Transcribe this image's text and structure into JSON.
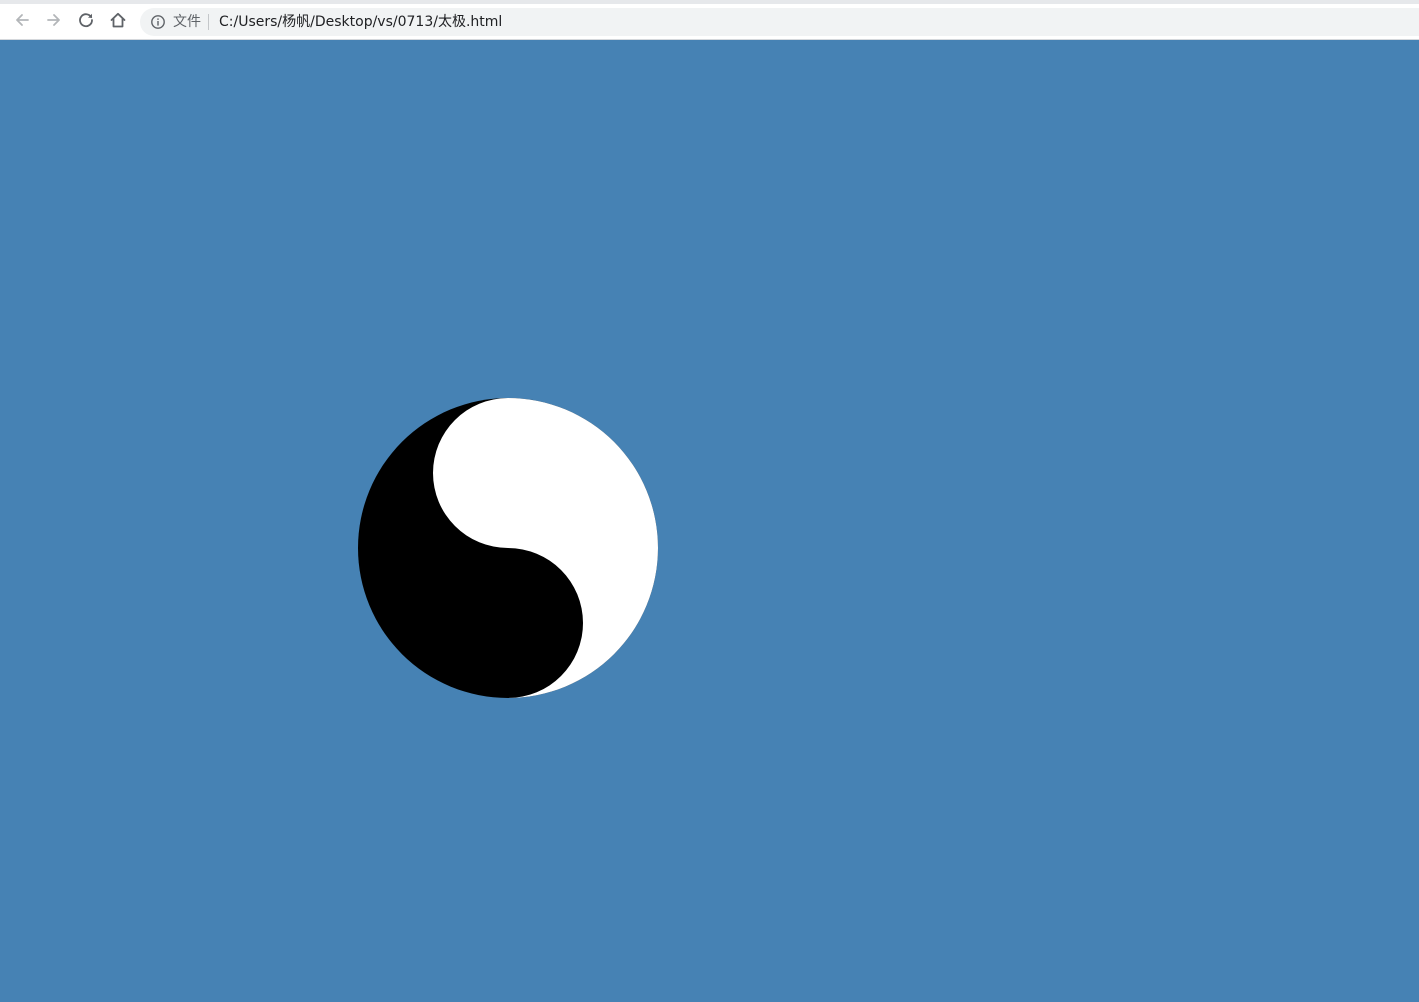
{
  "browser": {
    "nav": {
      "back_icon": "arrow-left-icon",
      "forward_icon": "arrow-right-icon",
      "reload_icon": "reload-icon",
      "home_icon": "home-icon"
    },
    "omnibox": {
      "site_info_icon": "info-icon",
      "site_label": "文件",
      "url": "C:/Users/杨帆/Desktop/vs/0713/太极.html"
    }
  },
  "colors": {
    "page_background": "#4682b4",
    "yin": "#000000",
    "yang": "#ffffff"
  }
}
